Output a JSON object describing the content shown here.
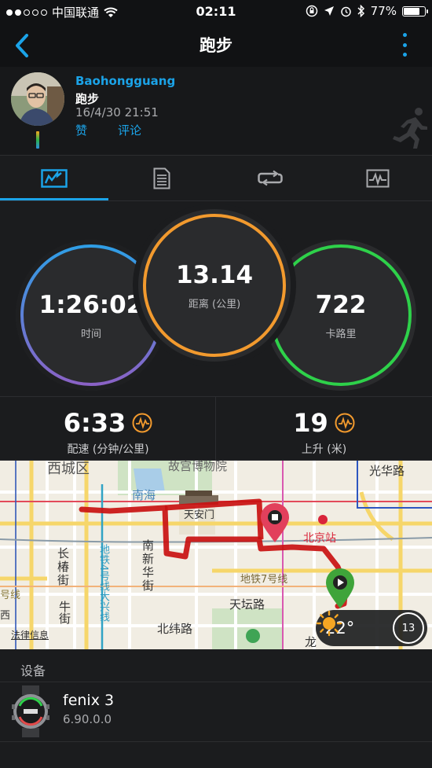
{
  "status_bar": {
    "carrier": "中国联通",
    "time": "02:11",
    "battery": "77%"
  },
  "nav": {
    "title": "跑步"
  },
  "profile": {
    "username": "Baohongguang",
    "activity": "跑步",
    "datetime": "16/4/30 21:51",
    "like": "赞",
    "comment": "评论"
  },
  "tabs": [
    {
      "icon": "stats-chart-icon",
      "active": true
    },
    {
      "icon": "document-list-icon",
      "active": false
    },
    {
      "icon": "laps-loop-icon",
      "active": false
    },
    {
      "icon": "heart-rate-graph-icon",
      "active": false
    }
  ],
  "rings": {
    "time": {
      "value": "1:26:02",
      "label": "时间",
      "color": "#3a9be0"
    },
    "distance": {
      "value": "13.14",
      "label": "距离 (公里)",
      "color": "#f29a2e"
    },
    "calories": {
      "value": "722",
      "label": "卡路里",
      "color": "#2ed14a"
    }
  },
  "stats": {
    "pace": {
      "value": "6:33",
      "label": "配速 (分钟/公里)"
    },
    "ascent": {
      "value": "19",
      "label": "上升 (米)"
    }
  },
  "map": {
    "labels": {
      "xicheng": "西城区",
      "museum": "故宫博物院",
      "guanghua": "光华路",
      "nanhai": "南海",
      "tiananmen": "天安门",
      "beijing_station": "北京站",
      "changchun": "长椿街",
      "line4": "地铁4号线大兴线",
      "nanxinhua": "南新华街",
      "line7": "地铁7号线",
      "niujie": "牛街",
      "tiantan": "天坛路",
      "beiwei": "北纬路",
      "legal": "法律信息",
      "line_left": "号线",
      "long": "龙",
      "west": "西"
    },
    "weather": {
      "temp": "22°",
      "wind": "13"
    }
  },
  "device": {
    "section_title": "设备",
    "name": "fenix 3",
    "version": "6.90.0.0"
  }
}
